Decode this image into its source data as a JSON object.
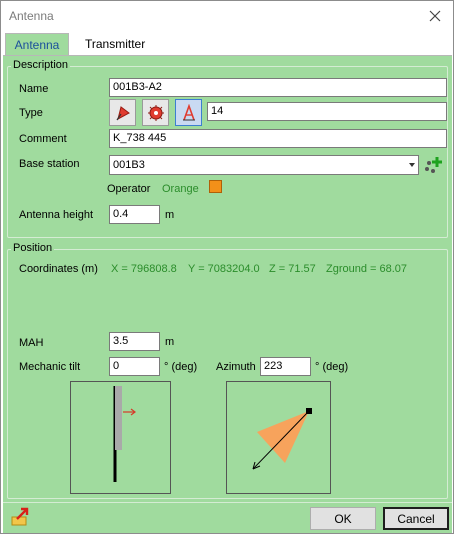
{
  "window": {
    "title": "Antenna"
  },
  "tabs": [
    {
      "label": "Antenna"
    },
    {
      "label": "Transmitter"
    }
  ],
  "description": {
    "legend": "Description",
    "name_label": "Name",
    "name_value": "001B3-A2",
    "type_label": "Type",
    "type_value": "14",
    "comment_label": "Comment",
    "comment_value": "K_738 445",
    "base_station_label": "Base station",
    "base_station_value": "001B3",
    "operator_label": "Operator",
    "operator_value": "Orange",
    "operator_color": "#f39019",
    "antenna_height_label": "Antenna height",
    "antenna_height_value": "0.4",
    "antenna_height_unit": "m"
  },
  "position": {
    "legend": "Position",
    "coordinates_label": "Coordinates (m)",
    "x_text": "X = 796808.8",
    "y_text": "Y = 7083204.0",
    "z_text": "Z = 71.57",
    "zground_text": "Zground = 68.07",
    "mah_label": "MAH",
    "mah_value": "3.5",
    "mah_unit": "m",
    "tilt_label": "Mechanic tilt",
    "tilt_value": "0",
    "tilt_unit": "° (deg)",
    "azimuth_label": "Azimuth",
    "azimuth_value": "223",
    "azimuth_unit": "° (deg)"
  },
  "footer": {
    "ok_label": "OK",
    "cancel_label": "Cancel"
  },
  "colors": {
    "panel": "#a0db9e",
    "accent_green": "#2b8d2b",
    "beam": "#f7a35c"
  }
}
